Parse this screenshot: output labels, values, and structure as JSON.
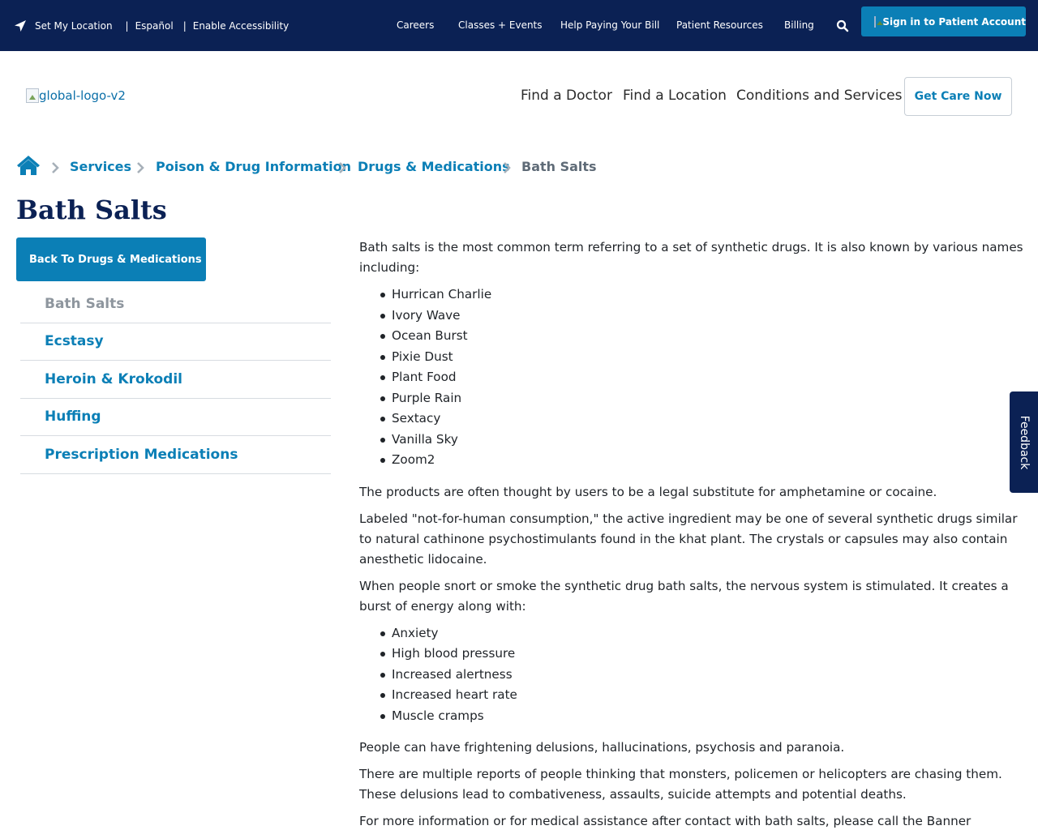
{
  "utility": {
    "set_location": "Set My Location",
    "espanol": "Español",
    "accessibility": "Enable Accessibility",
    "separator": "|",
    "nav": [
      "Careers",
      "Classes + Events",
      "Help Paying Your Bill",
      "Patient Resources",
      "Billing"
    ],
    "signin": "Sign in to Patient Account"
  },
  "header": {
    "logo_alt": "global-logo-v2",
    "nav": [
      "Find a Doctor",
      "Find a Location",
      "Conditions and Services"
    ],
    "cta": "Get Care Now"
  },
  "breadcrumb": [
    "Services",
    "Poison & Drug Information",
    "Drugs & Medications",
    "Bath Salts"
  ],
  "page_title": "Bath Salts",
  "sidebar": {
    "back_label": "Back To Drugs & Medications",
    "items": [
      "Bath Salts",
      "Ecstasy",
      "Heroin & Krokodil",
      "Huffing",
      "Prescription Medications"
    ]
  },
  "content": {
    "intro": "Bath salts is the most common term referring to a set of synthetic drugs. It is also known by various names including:",
    "names": [
      "Hurrican Charlie",
      "Ivory Wave",
      "Ocean Burst",
      "Pixie Dust",
      "Plant Food",
      "Purple Rain",
      "Sextacy",
      "Vanilla Sky",
      "Zoom2"
    ],
    "p2": "The products are often thought by users to be a legal substitute for amphetamine or cocaine.",
    "p3": "Labeled \"not-for-human consumption,\" the active ingredient may be one of several synthetic drugs similar to natural cathinone psychostimulants found in the khat plant. The crystals or capsules may also contain anesthetic lidocaine.",
    "p4": "When people snort or smoke the synthetic drug bath salts, the nervous system is stimulated. It creates a burst of energy along with:",
    "effects": [
      "Anxiety",
      "High blood pressure",
      "Increased alertness",
      "Increased heart rate",
      "Muscle cramps"
    ],
    "p5": "People can have frightening delusions, hallucinations, psychosis and paranoia.",
    "p6": "There are multiple reports of people thinking that monsters, policemen or helicopters are chasing them. These delusions lead to combativeness, assaults, suicide attempts and potential deaths.",
    "p7": "For more information or for medical assistance after contact with bath salts, please call the Banner"
  },
  "feedback": "Feedback",
  "colors": {
    "navy": "#0b2154",
    "blue": "#0b7fb6",
    "muted": "#8e969e"
  },
  "icons": {
    "location": "location-arrow-icon",
    "search": "search-icon",
    "home": "home-icon",
    "chevron": "chevron-right-icon"
  }
}
